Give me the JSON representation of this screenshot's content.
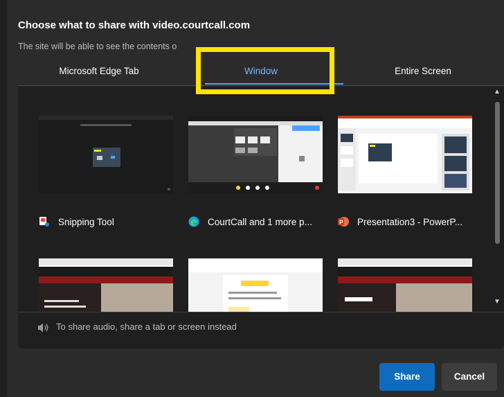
{
  "dialog": {
    "title": "Choose what to share with video.courtcall.com",
    "subtitle": "The site will be able to see the contents o"
  },
  "tabs": [
    {
      "label": "Microsoft Edge Tab",
      "selected": false
    },
    {
      "label": "Window",
      "selected": true
    },
    {
      "label": "Entire Screen",
      "selected": false
    }
  ],
  "windows": [
    {
      "label": "Snipping Tool",
      "icon": "snipping-tool-icon"
    },
    {
      "label": "CourtCall and 1 more p...",
      "icon": "edge-icon"
    },
    {
      "label": "Presentation3 - PowerP...",
      "icon": "powerpoint-icon"
    }
  ],
  "audio": {
    "text": "To share audio, share a tab or screen instead",
    "icon": "speaker-icon"
  },
  "buttons": {
    "share": "Share",
    "cancel": "Cancel"
  },
  "colors": {
    "accent": "#0f6cbd",
    "selected_tab_text": "#79b8ff",
    "highlight_box": "#ffe400"
  }
}
